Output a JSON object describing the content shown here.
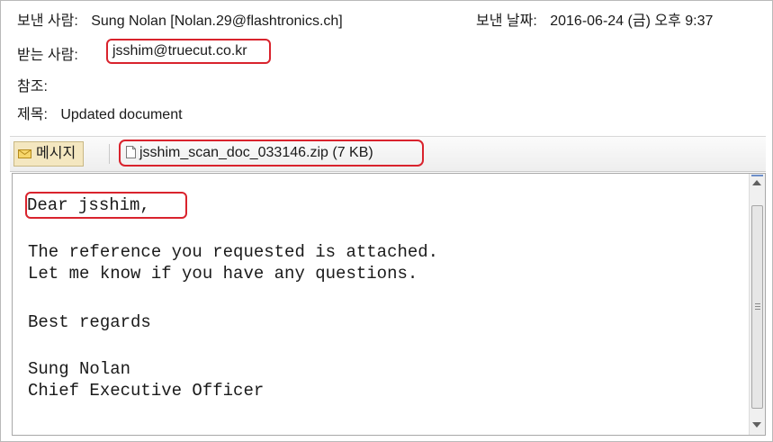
{
  "header": {
    "from_label": "보낸 사람:",
    "from_value": "Sung Nolan [Nolan.29@flashtronics.ch]",
    "date_label": "보낸 날짜:",
    "date_value": "2016-06-24 (금) 오후 9:37",
    "to_label": "받는 사람:",
    "to_value": "jsshim@truecut.co.kr",
    "cc_label": "참조:",
    "subject_label": "제목:",
    "subject_value": "Updated document"
  },
  "tabs": {
    "message_label": "메시지",
    "attachment_label": "jsshim_scan_doc_033146.zip (7 KB)"
  },
  "body": {
    "greeting": "Dear jsshim,",
    "line1": "The reference you requested is attached.",
    "line2": "Let me know if you have any questions.",
    "regards": "Best regards",
    "signature_name": "Sung Nolan",
    "signature_title": "Chief Executive Officer"
  },
  "colors": {
    "highlight_border": "#d9232d",
    "message_tab_bg": "#f4e7c0"
  },
  "icons": {
    "message_tab": "envelope-icon",
    "attachment": "document-icon"
  }
}
